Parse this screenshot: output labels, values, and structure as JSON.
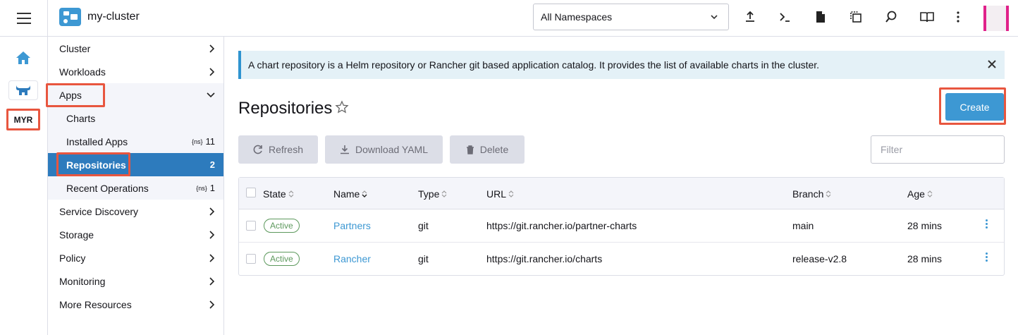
{
  "header": {
    "cluster_name": "my-cluster",
    "namespace": "All Namespaces"
  },
  "rail": {
    "current_cluster_abbr": "MYR"
  },
  "sidenav": {
    "items": [
      {
        "label": "Cluster"
      },
      {
        "label": "Workloads"
      },
      {
        "label": "Apps"
      },
      {
        "label": "Service Discovery"
      },
      {
        "label": "Storage"
      },
      {
        "label": "Policy"
      },
      {
        "label": "Monitoring"
      },
      {
        "label": "More Resources"
      }
    ],
    "apps_children": [
      {
        "label": "Charts",
        "count": ""
      },
      {
        "label": "Installed Apps",
        "count": "11"
      },
      {
        "label": "Repositories",
        "count": "2"
      },
      {
        "label": "Recent Operations",
        "count": "1"
      }
    ]
  },
  "banner": {
    "text": "A chart repository is a Helm repository or Rancher git based application catalog. It provides the list of available charts in the cluster."
  },
  "page": {
    "title": "Repositories",
    "create_label": "Create",
    "refresh_label": "Refresh",
    "download_label": "Download YAML",
    "delete_label": "Delete",
    "filter_placeholder": "Filter"
  },
  "table": {
    "headers": [
      "State",
      "Name",
      "Type",
      "URL",
      "Branch",
      "Age"
    ],
    "rows": [
      {
        "state": "Active",
        "name": "Partners",
        "type": "git",
        "url": "https://git.rancher.io/partner-charts",
        "branch": "main",
        "age": "28 mins"
      },
      {
        "state": "Active",
        "name": "Rancher",
        "type": "git",
        "url": "https://git.rancher.io/charts",
        "branch": "release-v2.8",
        "age": "28 mins"
      }
    ]
  },
  "colors": {
    "accent": "#3d98d3",
    "active_nav": "#2d7bbd",
    "highlight": "#e8563f",
    "status_active": "#5d995d",
    "avatar": "#e0218a"
  }
}
